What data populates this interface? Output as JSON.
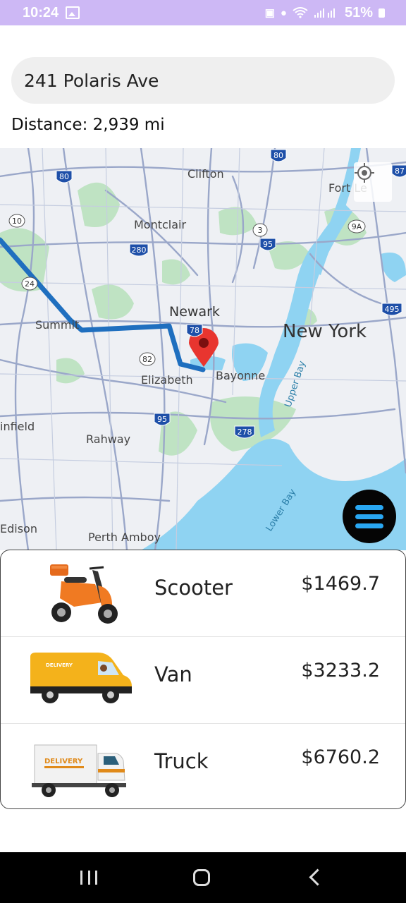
{
  "status_bar": {
    "time": "10:24",
    "battery": "51%",
    "icons": [
      "image-icon",
      "lock-icon",
      "location-icon",
      "wifi-icon",
      "signal-icon",
      "battery-icon"
    ]
  },
  "search": {
    "value": "241 Polaris Ave"
  },
  "distance": "Distance: 2,939 mi",
  "map": {
    "labels": {
      "clifton": "Clifton",
      "montclair": "Montclair",
      "newark": "Newark",
      "new_york": "New York",
      "summit": "Summit",
      "elizabeth": "Elizabeth",
      "bayonne": "Bayonne",
      "upper_bay": "Upper Bay",
      "infield": "infield",
      "rahway": "Rahway",
      "lower_bay": "Lower Bay",
      "edison": "Edison",
      "perth_amboy": "Perth Amboy",
      "fort_lee": "Fort Le"
    },
    "shields": {
      "i80_a": "80",
      "i80_b": "80",
      "i87": "87",
      "r10": "10",
      "r3": "3",
      "r9a": "9A",
      "i95_a": "95",
      "i280": "280",
      "r24": "24",
      "i495": "495",
      "r82": "82",
      "i95_b": "95",
      "i278": "278",
      "i78": "78"
    },
    "route_color": "#1f6fbf",
    "pin_color": "#e8352f",
    "water_color": "#8fd3f2",
    "park_color": "#bfe3c3"
  },
  "vehicles": [
    {
      "name": "Scooter",
      "price": "$1469.7",
      "icon": "scooter-icon"
    },
    {
      "name": "Van",
      "price": "$3233.2",
      "icon": "van-icon",
      "decal": "DELIVERY"
    },
    {
      "name": "Truck",
      "price": "$6760.2",
      "icon": "truck-icon",
      "decal": "DELIVERY"
    }
  ]
}
